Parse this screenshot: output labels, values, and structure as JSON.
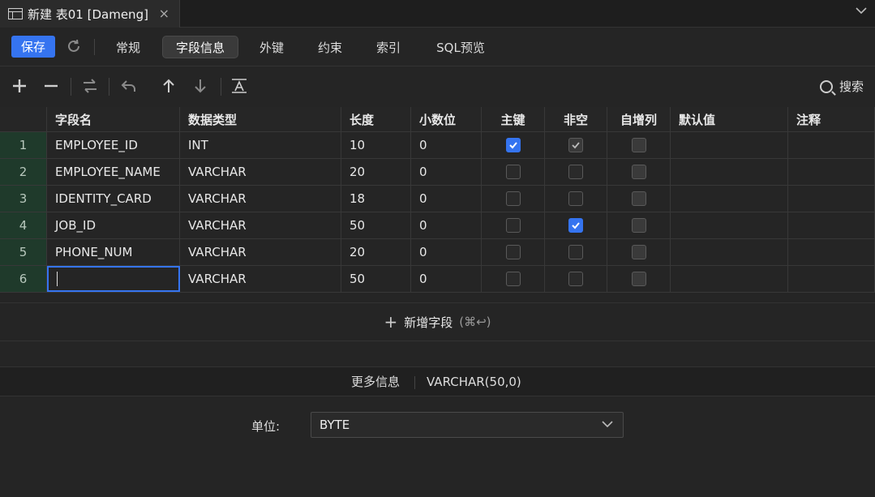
{
  "tab": {
    "title": "新建 表01 [Dameng]",
    "close": "×"
  },
  "toolbar": {
    "save_label": "保存",
    "nav": [
      "常规",
      "字段信息",
      "外键",
      "约束",
      "索引",
      "SQL预览"
    ],
    "active_nav": "字段信息"
  },
  "edit": {
    "search_label": "搜索"
  },
  "grid": {
    "headers": [
      "字段名",
      "数据类型",
      "长度",
      "小数位",
      "主键",
      "非空",
      "自增列",
      "默认值",
      "注释"
    ],
    "rows": [
      {
        "num": "1",
        "name": "EMPLOYEE_ID",
        "type": "INT",
        "length": "10",
        "scale": "0",
        "pk": true,
        "notnull": true,
        "notnull_disabled": true,
        "auto": false,
        "default": "",
        "comment": ""
      },
      {
        "num": "2",
        "name": "EMPLOYEE_NAME",
        "type": "VARCHAR",
        "length": "20",
        "scale": "0",
        "pk": false,
        "notnull": false,
        "auto": false,
        "default": "",
        "comment": ""
      },
      {
        "num": "3",
        "name": "IDENTITY_CARD",
        "type": "VARCHAR",
        "length": "18",
        "scale": "0",
        "pk": false,
        "notnull": false,
        "auto": false,
        "default": "",
        "comment": ""
      },
      {
        "num": "4",
        "name": "JOB_ID",
        "type": "VARCHAR",
        "length": "50",
        "scale": "0",
        "pk": false,
        "notnull": true,
        "auto": false,
        "default": "",
        "comment": ""
      },
      {
        "num": "5",
        "name": "PHONE_NUM",
        "type": "VARCHAR",
        "length": "20",
        "scale": "0",
        "pk": false,
        "notnull": false,
        "auto": false,
        "default": "",
        "comment": ""
      },
      {
        "num": "6",
        "name": "",
        "type": "VARCHAR",
        "length": "50",
        "scale": "0",
        "pk": false,
        "notnull": false,
        "auto": false,
        "default": "",
        "comment": ""
      }
    ]
  },
  "add_field": {
    "label": "新增字段",
    "shortcut": "(⌘↩)"
  },
  "info": {
    "label": "更多信息",
    "value": "VARCHAR(50,0)"
  },
  "unit": {
    "label": "单位:",
    "value": "BYTE"
  },
  "colors": {
    "accent": "#3574f0",
    "rownum_bg": "#1f3a2b"
  }
}
